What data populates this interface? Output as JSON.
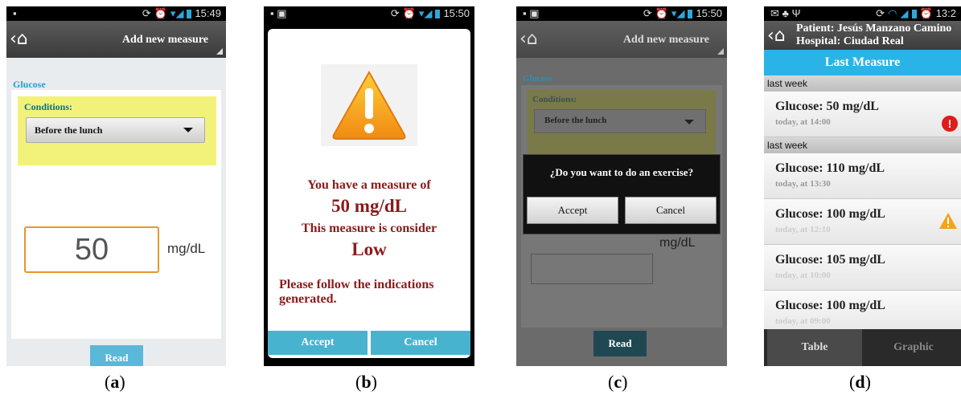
{
  "panel_a": {
    "status_time": "15:49",
    "action_title": "Add new measure",
    "section_label": "Glucose",
    "conditions_label": "Conditions:",
    "condition_value": "Before the lunch",
    "measure_value": "50",
    "unit": "mg/dL",
    "read_button": "Read",
    "caption": "a"
  },
  "panel_b": {
    "status_time": "15:50",
    "line1": "You have a measure of",
    "line2": "50 mg/dL",
    "line3": "This measure is consider",
    "line4": "Low",
    "line5": "Please follow the indications generated.",
    "accept": "Accept",
    "cancel": "Cancel",
    "caption": "b"
  },
  "panel_c": {
    "status_time": "15:50",
    "action_title": "Add new measure",
    "section_label": "Glucose",
    "conditions_label": "Conditions:",
    "condition_value": "Before the lunch",
    "question": "¿Do you want to do an exercise?",
    "accept": "Accept",
    "cancel": "Cancel",
    "unit": "mg/dL",
    "read_button": "Read",
    "caption": "c"
  },
  "panel_d": {
    "status_time": "13:2",
    "patient": "Patient: Jesús Manzano Camino",
    "hospital": "Hospital: Ciudad Real",
    "title": "Last Measure",
    "sections": [
      "last week",
      "last week"
    ],
    "rows": [
      {
        "title": "Glucose: 50 mg/dL",
        "sub": "today, at 14:00",
        "alert": "red-exclamation-icon"
      },
      {
        "title": "Glucose: 110 mg/dL",
        "sub": "today, at 13:30",
        "alert": ""
      },
      {
        "title": "Glucose: 100 mg/dL",
        "sub": "today, at 12:10",
        "alert": "warning-triangle-icon"
      },
      {
        "title": "Glucose: 105 mg/dL",
        "sub": "today, at 10:00",
        "alert": ""
      },
      {
        "title": "Glucose: 100 mg/dL",
        "sub": "today, at 09:00",
        "alert": ""
      }
    ],
    "tab_table": "Table",
    "tab_graphic": "Graphic",
    "caption": "d"
  },
  "colors": {
    "accent_blue": "#2ab3e6",
    "alert_text": "#8b1a1a",
    "warning_orange": "#f6a21b",
    "condition_yellow": "#f2f27a"
  }
}
